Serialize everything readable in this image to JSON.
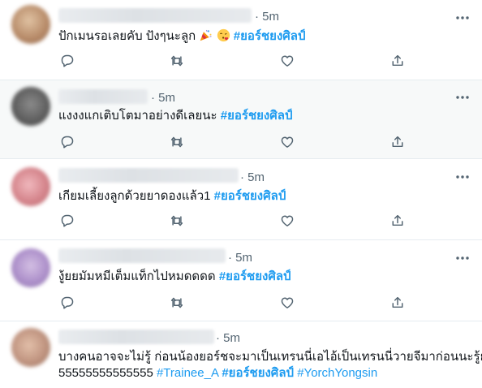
{
  "colors": {
    "link": "#1d9bf0",
    "muted": "#536471",
    "text": "#0f1419",
    "divider": "#e6ecf0"
  },
  "tweets": [
    {
      "time": "· 5m",
      "text": "ปักเมนรอเลยคับ ปังๆนะลูก",
      "emojis": [
        "party-popper",
        "face-blowing-kiss"
      ],
      "hashtags": [
        "#ยอร์ชยงศิลป์"
      ],
      "avatar_color": "#c9a27f"
    },
    {
      "time": "· 5m",
      "text": "แงงงแกเติบโตมาอย่างดีเลยนะ",
      "hashtags": [
        "#ยอร์ชยงศิลป์"
      ],
      "avatar_color": "#6f6f6f"
    },
    {
      "time": "· 5m",
      "text": "เกียมเลี้ยงลูกด้วยยาดองแล้ว1",
      "hashtags": [
        "#ยอร์ชยงศิลป์"
      ],
      "avatar_color": "#d7888f"
    },
    {
      "time": "· 5m",
      "text": "งู้ยยมัมหมีเต็มแท็กไปหมดดดด",
      "hashtags": [
        "#ยอร์ชยงศิลป์"
      ],
      "avatar_color": "#a98bc4"
    },
    {
      "time": "· 5m",
      "text_line1": "บางคนอาจจะไม่รู้ ก่อนน้องยอร์ชจะมาเป็นเทรนนี่เอไอ้เป็นเทรนนี่วายจีมาก่อนนะรู้ยัง",
      "text_line2": "55555555555555",
      "hashtags": [
        "#Trainee_A",
        "#ยอร์ชยงศิลป์",
        "#YorchYongsin"
      ],
      "avatar_color": "#c29a85"
    }
  ],
  "icons": {
    "more": "more-dots-icon",
    "reply": "reply-icon",
    "retweet": "retweet-icon",
    "like": "like-icon",
    "share": "share-icon"
  }
}
